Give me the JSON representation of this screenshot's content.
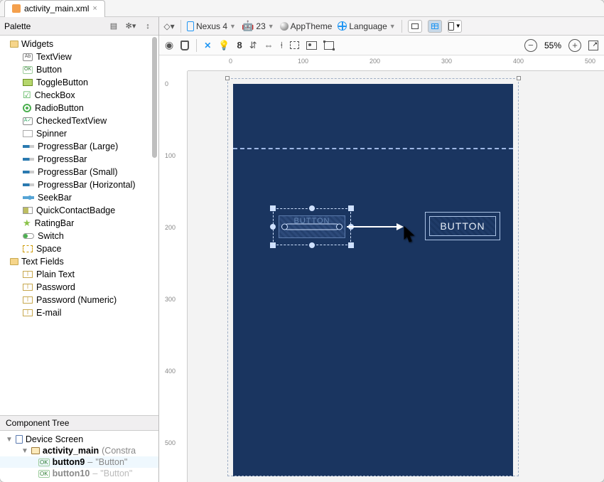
{
  "tab": {
    "filename": "activity_main.xml",
    "close": "×"
  },
  "palette": {
    "title": "Palette",
    "groups": {
      "widgets": "Widgets",
      "textfields": "Text Fields"
    },
    "items": {
      "textview": "TextView",
      "button": "Button",
      "toggle": "ToggleButton",
      "checkbox": "CheckBox",
      "radio": "RadioButton",
      "checkedtv": "CheckedTextView",
      "spinner": "Spinner",
      "pbL": "ProgressBar (Large)",
      "pb": "ProgressBar",
      "pbS": "ProgressBar (Small)",
      "pbH": "ProgressBar (Horizontal)",
      "seek": "SeekBar",
      "qcb": "QuickContactBadge",
      "rating": "RatingBar",
      "switch": "Switch",
      "space": "Space",
      "plain": "Plain Text",
      "password": "Password",
      "passwordN": "Password (Numeric)",
      "email": "E-mail"
    }
  },
  "component_tree": {
    "title": "Component Tree",
    "device": "Device Screen",
    "root": "activity_main",
    "root_suffix": "(Constra",
    "c1_name": "button9",
    "c1_text": "\"Button\"",
    "c2_name": "button10",
    "c2_text": "\"Button\"",
    "dash": " – "
  },
  "toolbar": {
    "device": "Nexus 4",
    "api": "23",
    "theme": "AppTheme",
    "lang": "Language"
  },
  "design_toolbar": {
    "margin": "8"
  },
  "zoom": {
    "value": "55%"
  },
  "ruler_h": [
    "0",
    "100",
    "200",
    "300",
    "400",
    "500"
  ],
  "ruler_v": [
    "0",
    "100",
    "200",
    "300",
    "400",
    "500"
  ],
  "canvas": {
    "sel_label": "BUTTON",
    "button2": "BUTTON"
  },
  "icons": {
    "ok": "OK",
    "ab": "Ab",
    "av": "A✓",
    "I": "I"
  }
}
